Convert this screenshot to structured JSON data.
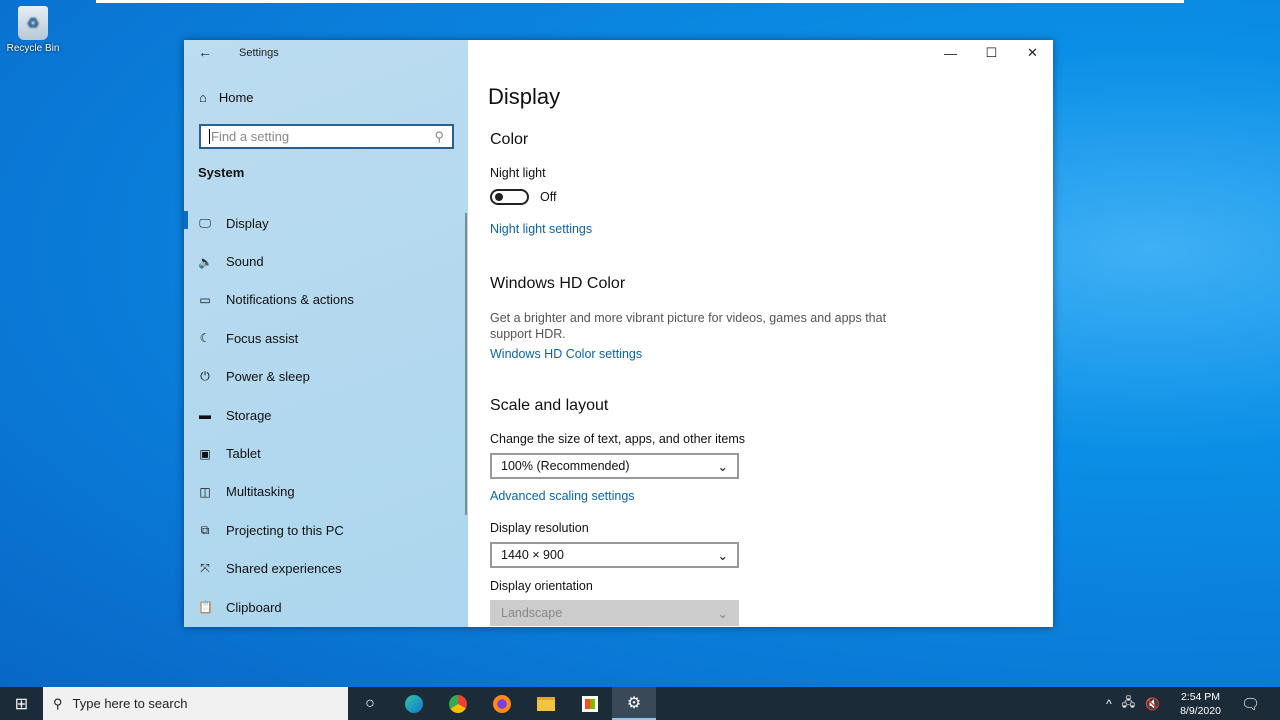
{
  "desktop": {
    "recycle_bin": "Recycle Bin"
  },
  "window": {
    "title": "Settings",
    "controls": [
      "minimize",
      "maximize",
      "close"
    ]
  },
  "sidebar": {
    "home": "Home",
    "search_placeholder": "Find a setting",
    "section": "System",
    "items": [
      {
        "label": "Display",
        "icon": "monitor-icon",
        "active": true
      },
      {
        "label": "Sound",
        "icon": "speaker-icon"
      },
      {
        "label": "Notifications & actions",
        "icon": "notification-icon"
      },
      {
        "label": "Focus assist",
        "icon": "moon-icon"
      },
      {
        "label": "Power & sleep",
        "icon": "power-icon"
      },
      {
        "label": "Storage",
        "icon": "storage-icon"
      },
      {
        "label": "Tablet",
        "icon": "tablet-icon"
      },
      {
        "label": "Multitasking",
        "icon": "multitasking-icon"
      },
      {
        "label": "Projecting to this PC",
        "icon": "projector-icon"
      },
      {
        "label": "Shared experiences",
        "icon": "shared-icon"
      },
      {
        "label": "Clipboard",
        "icon": "clipboard-icon"
      }
    ]
  },
  "main": {
    "title": "Display",
    "color": {
      "heading": "Color",
      "night_light_label": "Night light",
      "night_light_state": "Off",
      "night_light_on": false,
      "night_light_link": "Night light settings"
    },
    "hdr": {
      "heading": "Windows HD Color",
      "description": "Get a brighter and more vibrant picture for videos, games and apps that support HDR.",
      "link": "Windows HD Color settings"
    },
    "scale": {
      "heading": "Scale and layout",
      "size_label": "Change the size of text, apps, and other items",
      "size_value": "100% (Recommended)",
      "advanced_link": "Advanced scaling settings",
      "resolution_label": "Display resolution",
      "resolution_value": "1440 × 900",
      "orientation_label": "Display orientation",
      "orientation_value": "Landscape"
    }
  },
  "taskbar": {
    "search_placeholder": "Type here to search",
    "time": "2:54 PM",
    "date": "8/9/2020"
  },
  "colors": {
    "accent": "#0a64b0",
    "taskbar": "#1c2b38"
  }
}
